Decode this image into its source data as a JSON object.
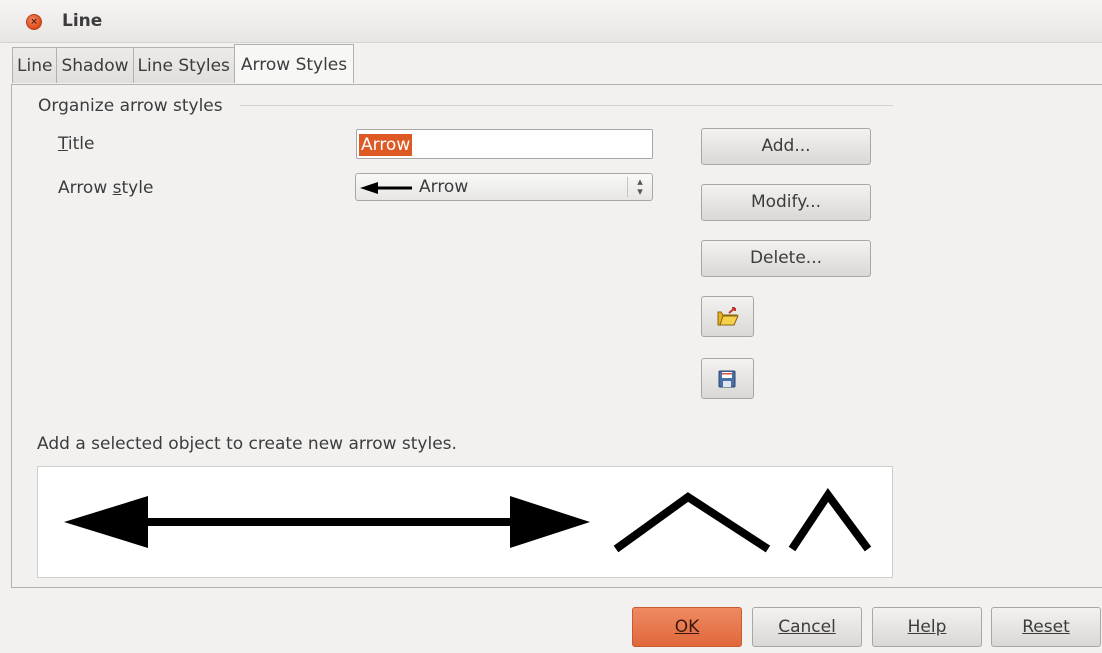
{
  "window": {
    "title": "Line",
    "close_icon": "close-icon"
  },
  "tabs": [
    {
      "label": "Line",
      "active": false
    },
    {
      "label": "Shadow",
      "active": false
    },
    {
      "label": "Line Styles",
      "active": false
    },
    {
      "label": "Arrow Styles",
      "active": true
    }
  ],
  "organize": {
    "group_label": "Organize arrow styles",
    "title_label": "Title",
    "title_value": "Arrow",
    "arrow_style_label": "Arrow style",
    "arrow_style_value": "Arrow"
  },
  "side_buttons": {
    "add": "Add...",
    "modify": "Modify...",
    "delete": "Delete...",
    "load_icon": "open-folder-icon",
    "save_icon": "save-disk-icon"
  },
  "hint": "Add a selected object to create new arrow styles.",
  "footer": {
    "ok": "OK",
    "cancel": "Cancel",
    "help": "Help",
    "reset": "Reset"
  },
  "colors": {
    "accent": "#dd5a24",
    "ok_button": "#e8784c",
    "window_bg": "#f2f1f0"
  }
}
